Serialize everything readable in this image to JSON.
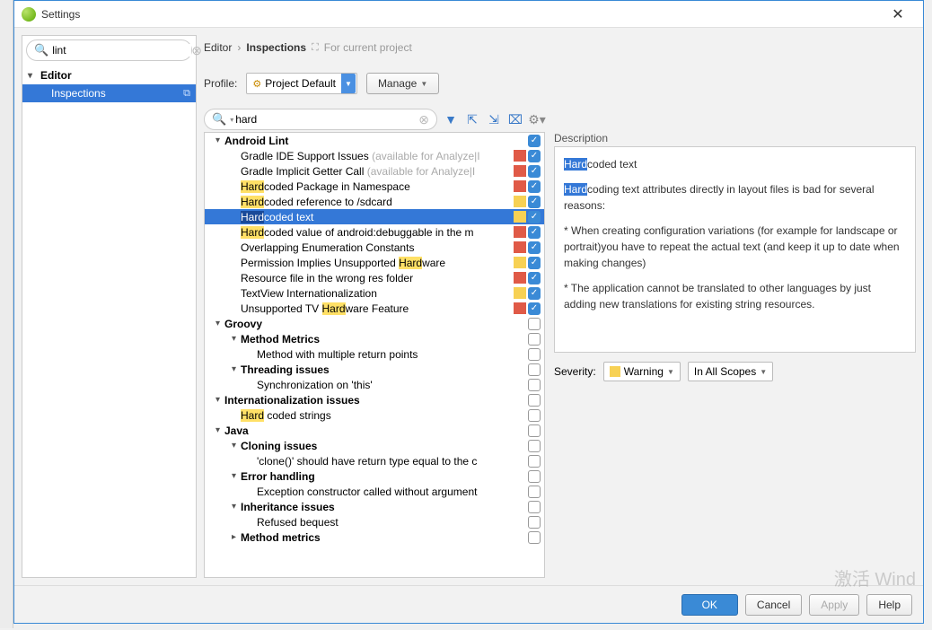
{
  "window": {
    "title": "Settings"
  },
  "sidebar": {
    "search_value": "lint",
    "items": [
      {
        "label": "Editor",
        "bold": true,
        "arrow": true
      },
      {
        "label": "Inspections",
        "selected": true
      }
    ]
  },
  "breadcrumb": {
    "parent": "Editor",
    "current": "Inspections",
    "scope": "For current project"
  },
  "profile": {
    "label": "Profile:",
    "value": "Project Default",
    "manage": "Manage"
  },
  "filter": {
    "search_value": "hard"
  },
  "inspection_tree": [
    {
      "depth": 0,
      "arrow": "down",
      "bold": true,
      "text_parts": [
        {
          "t": "Android Lint"
        }
      ],
      "sev": null,
      "checked": true
    },
    {
      "depth": 1,
      "text_parts": [
        {
          "t": "Gradle IDE Support Issues "
        },
        {
          "t": "(available for Analyze|I",
          "gray": true
        }
      ],
      "sev": "red",
      "checked": true
    },
    {
      "depth": 1,
      "text_parts": [
        {
          "t": "Gradle Implicit Getter Call "
        },
        {
          "t": "(available for Analyze|I",
          "gray": true
        }
      ],
      "sev": "red",
      "checked": true
    },
    {
      "depth": 1,
      "text_parts": [
        {
          "t": "Hard",
          "hl": true
        },
        {
          "t": "coded Package in Namespace"
        }
      ],
      "sev": "red",
      "checked": true
    },
    {
      "depth": 1,
      "text_parts": [
        {
          "t": "Hard",
          "hl": true
        },
        {
          "t": "coded reference to /sdcard"
        }
      ],
      "sev": "yellow",
      "checked": true
    },
    {
      "depth": 1,
      "selected": true,
      "text_parts": [
        {
          "t": "Hard",
          "hl": true
        },
        {
          "t": "coded text"
        }
      ],
      "sev": "yellow",
      "checked": true
    },
    {
      "depth": 1,
      "text_parts": [
        {
          "t": "Hard",
          "hl": true
        },
        {
          "t": "coded value of android:debuggable in the m"
        }
      ],
      "sev": "red",
      "checked": true
    },
    {
      "depth": 1,
      "text_parts": [
        {
          "t": "Overlapping Enumeration Constants"
        }
      ],
      "sev": "red",
      "checked": true
    },
    {
      "depth": 1,
      "text_parts": [
        {
          "t": "Permission Implies Unsupported "
        },
        {
          "t": "Hard",
          "hl": true
        },
        {
          "t": "ware"
        }
      ],
      "sev": "yellow",
      "checked": true
    },
    {
      "depth": 1,
      "text_parts": [
        {
          "t": "Resource file in the wrong res folder"
        }
      ],
      "sev": "red",
      "checked": true
    },
    {
      "depth": 1,
      "text_parts": [
        {
          "t": "TextView Internationalization"
        }
      ],
      "sev": "yellow",
      "checked": true
    },
    {
      "depth": 1,
      "text_parts": [
        {
          "t": "Unsupported TV "
        },
        {
          "t": "Hard",
          "hl": true
        },
        {
          "t": "ware Feature"
        }
      ],
      "sev": "red",
      "checked": true
    },
    {
      "depth": 0,
      "arrow": "down",
      "bold": true,
      "text_parts": [
        {
          "t": "Groovy"
        }
      ],
      "checked": false
    },
    {
      "depth": 1,
      "arrow": "down",
      "bold": true,
      "text_parts": [
        {
          "t": "Method Metrics"
        }
      ],
      "checked": false
    },
    {
      "depth": 2,
      "text_parts": [
        {
          "t": "Method with multiple return points"
        }
      ],
      "checked": false
    },
    {
      "depth": 1,
      "arrow": "down",
      "bold": true,
      "text_parts": [
        {
          "t": "Threading issues"
        }
      ],
      "checked": false
    },
    {
      "depth": 2,
      "text_parts": [
        {
          "t": "Synchronization on 'this'"
        }
      ],
      "checked": false
    },
    {
      "depth": 0,
      "arrow": "down",
      "bold": true,
      "text_parts": [
        {
          "t": "Internationalization issues"
        }
      ],
      "checked": false
    },
    {
      "depth": 1,
      "text_parts": [
        {
          "t": "Hard",
          "hl": true
        },
        {
          "t": " coded strings"
        }
      ],
      "checked": false
    },
    {
      "depth": 0,
      "arrow": "down",
      "bold": true,
      "text_parts": [
        {
          "t": "Java"
        }
      ],
      "checked": false
    },
    {
      "depth": 1,
      "arrow": "down",
      "bold": true,
      "text_parts": [
        {
          "t": "Cloning issues"
        }
      ],
      "checked": false
    },
    {
      "depth": 2,
      "text_parts": [
        {
          "t": "'clone()' should have return type equal to the c"
        }
      ],
      "checked": false
    },
    {
      "depth": 1,
      "arrow": "down",
      "bold": true,
      "text_parts": [
        {
          "t": "Error handling"
        }
      ],
      "checked": false
    },
    {
      "depth": 2,
      "text_parts": [
        {
          "t": "Exception constructor called without argument"
        }
      ],
      "checked": false
    },
    {
      "depth": 1,
      "arrow": "down",
      "bold": true,
      "text_parts": [
        {
          "t": "Inheritance issues"
        }
      ],
      "checked": false
    },
    {
      "depth": 2,
      "text_parts": [
        {
          "t": "Refused bequest"
        }
      ],
      "checked": false
    },
    {
      "depth": 1,
      "arrow": "right",
      "bold": true,
      "text_parts": [
        {
          "t": "Method metrics"
        }
      ],
      "checked": false
    }
  ],
  "description": {
    "label": "Description",
    "title_hl": "Hard",
    "title_rest": "coded text",
    "p1_hl": "Hard",
    "p1_rest": "coding text attributes directly in layout files is bad for several reasons:",
    "p2": "* When creating configuration variations (for example for landscape or portrait)you have to repeat the actual text (and keep it up to date when making changes)",
    "p3": "* The application cannot be translated to other languages by just adding new translations for existing string resources."
  },
  "severity": {
    "label": "Severity:",
    "value": "Warning",
    "scope": "In All Scopes"
  },
  "footer": {
    "ok": "OK",
    "cancel": "Cancel",
    "apply": "Apply",
    "help": "Help"
  },
  "watermark": "激活 Wind"
}
